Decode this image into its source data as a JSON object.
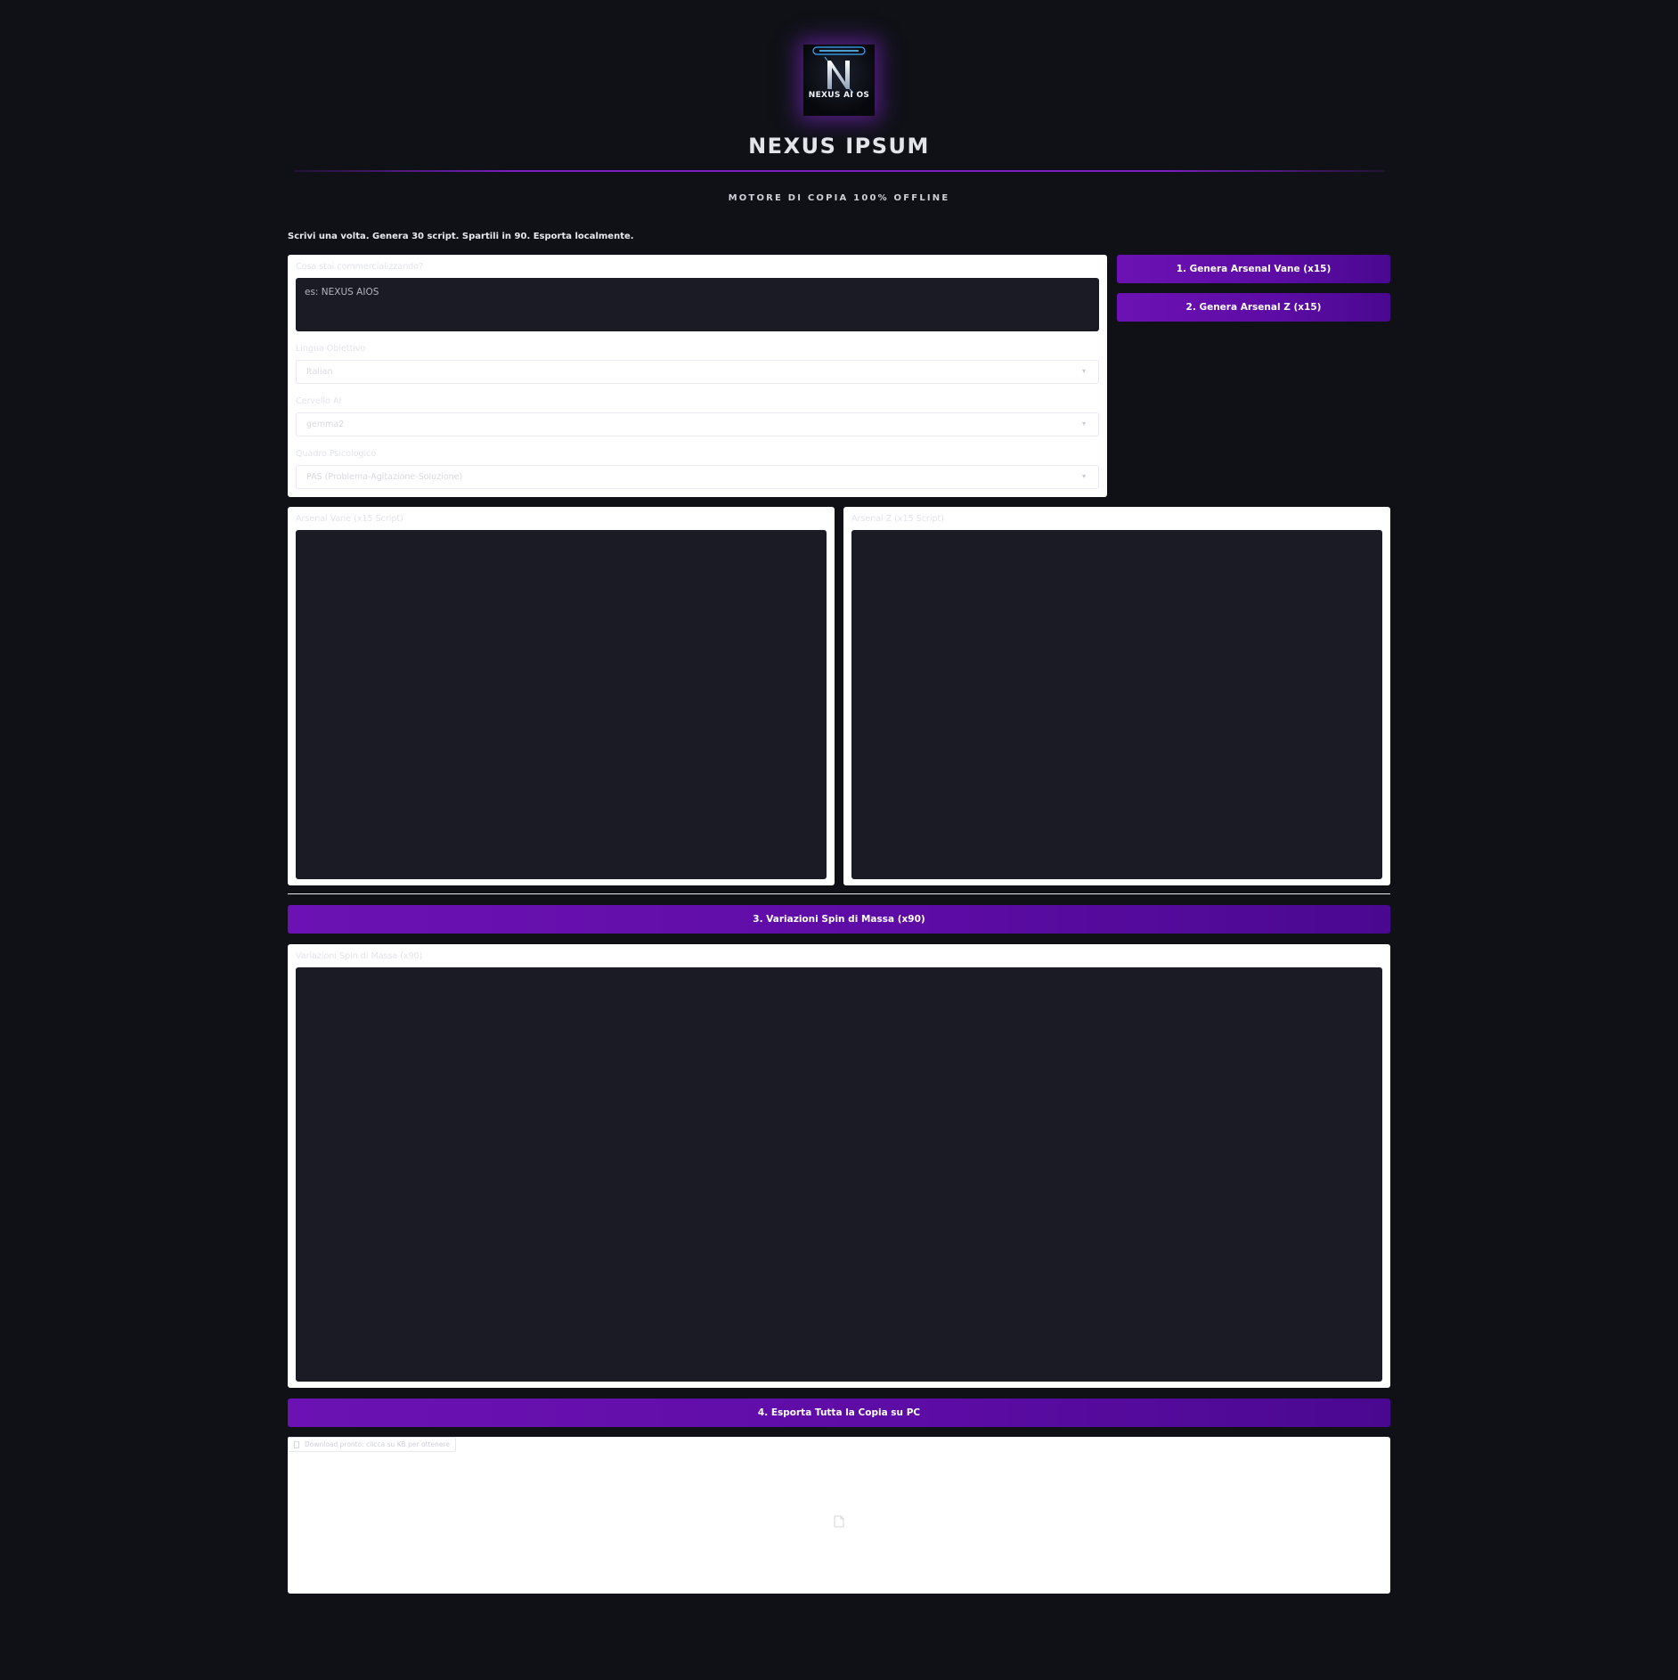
{
  "header": {
    "logo_alt": "NEXUS AI OS",
    "logo_text": "NEXUS AI OS",
    "title": "NEXUS IPSUM",
    "subtitle": "MOTORE DI COPIA 100% OFFLINE",
    "tagline": "Scrivi una volta. Genera 30 script. Spartili in 90. Esporta localmente."
  },
  "form": {
    "product_label": "Cosa stai commercializzando?",
    "product_placeholder": "es: NEXUS AIOS",
    "language_label": "Lingua Obiettivo",
    "language_value": "Italian",
    "brain_label": "Cervello AI",
    "brain_value": "gemma2",
    "framework_label": "Quadro Psicologico",
    "framework_value": "PAS (Problema-Agitazione-Soluzione)"
  },
  "actions": {
    "generate_vane": "1. Genera Arsenal Vane (x15)",
    "generate_z": "2. Genera Arsenal Z (x15)",
    "spin": "3. Variazioni Spin di Massa (x90)",
    "export": "4. Esporta Tutta la Copia su PC"
  },
  "outputs": {
    "vane_label": "Arsenal Vane (x15 Script)",
    "z_label": "Arsenal Z (x15 Script)",
    "spin_label": "Variazioni Spin di Massa (x90)"
  },
  "download": {
    "label": "Download pronto: clicca su KB per ottenere"
  },
  "icons": {
    "chevron": "chevron-down-icon",
    "file": "file-icon",
    "document": "document-icon"
  },
  "colors": {
    "background": "#0f1117",
    "accent": "#6c12b4",
    "panel": "#ffffff",
    "field_dark": "#1a1b25"
  }
}
